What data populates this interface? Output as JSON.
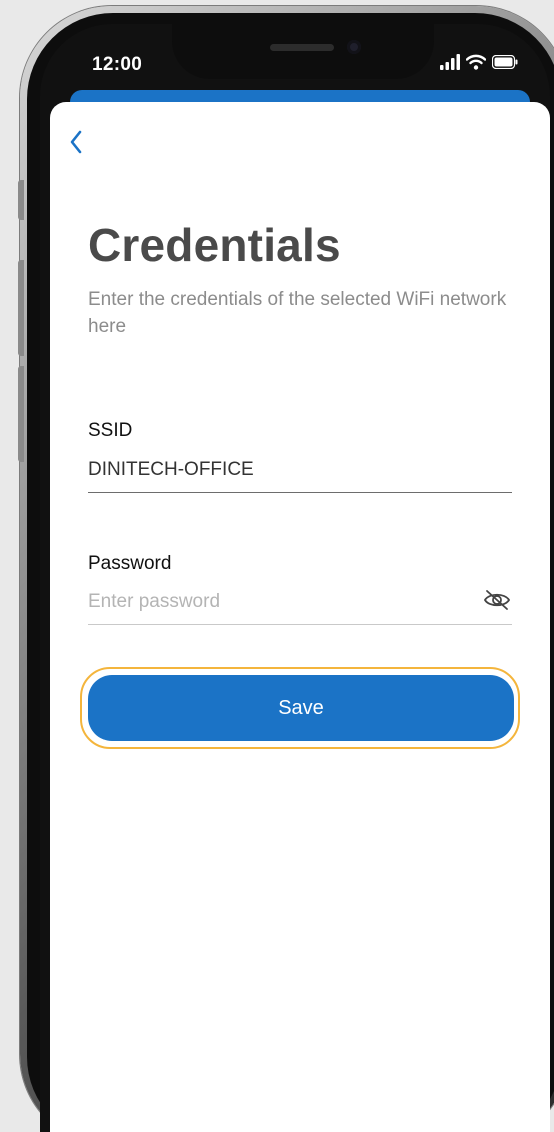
{
  "status_bar": {
    "time": "12:00",
    "icons": [
      "cellular-signal-icon",
      "wifi-icon",
      "battery-icon"
    ]
  },
  "header": {
    "back_icon": "chevron-left-icon"
  },
  "page": {
    "title": "Credentials",
    "subtitle": "Enter the credentials of the selected WiFi network here"
  },
  "form": {
    "ssid": {
      "label": "SSID",
      "value": "DINITECH-OFFICE"
    },
    "password": {
      "label": "Password",
      "value": "",
      "placeholder": "Enter password",
      "visibility_icon": "eye-slash-icon"
    },
    "save_label": "Save"
  },
  "colors": {
    "primary": "#1b73c6",
    "focus_ring": "#f4b53c",
    "title": "#4a4a4a",
    "subtitle": "#8c8c8c"
  }
}
